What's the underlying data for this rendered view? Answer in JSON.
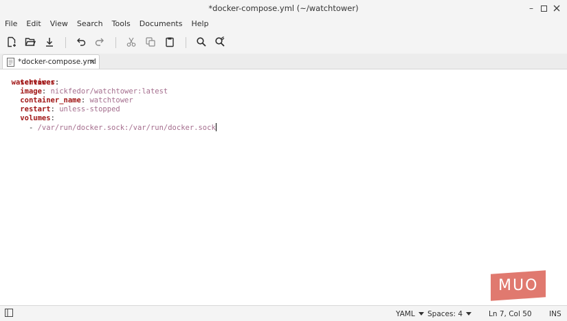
{
  "window": {
    "title": "*docker-compose.yml (~/watchtower)"
  },
  "menu": [
    "File",
    "Edit",
    "View",
    "Search",
    "Tools",
    "Documents",
    "Help"
  ],
  "toolbar": {
    "icons": [
      "new-document-icon",
      "open-folder-icon",
      "save-download-icon",
      "undo-icon",
      "redo-icon",
      "cut-icon",
      "copy-icon",
      "paste-icon",
      "search-icon",
      "search-replace-icon"
    ]
  },
  "tab": {
    "label": "*docker-compose.yml",
    "close": "×"
  },
  "editor": {
    "lines": [
      {
        "key": "services",
        "colon": ":",
        "value": ""
      },
      {
        "key": "watchtower",
        "colon": ":",
        "value": ""
      },
      {
        "key": "image",
        "colon": ":",
        "value": "nickfedor/watchtower:latest"
      },
      {
        "key": "container_name",
        "colon": ":",
        "value": "watchtower"
      },
      {
        "key": "restart",
        "colon": ":",
        "value": "unless-stopped"
      },
      {
        "key": "volumes",
        "colon": ":",
        "value": ""
      },
      {
        "dash": "- ",
        "value": "/var/run/docker.sock:/var/run/docker.sock"
      }
    ]
  },
  "logo": {
    "text": "MUO"
  },
  "statusbar": {
    "language": "YAML",
    "spaces": "Spaces: 4",
    "position": "Ln 7, Col 50",
    "mode": "INS"
  },
  "colors": {
    "key": "#a01616",
    "value": "#a46d8d",
    "logo": "#e0796f"
  }
}
